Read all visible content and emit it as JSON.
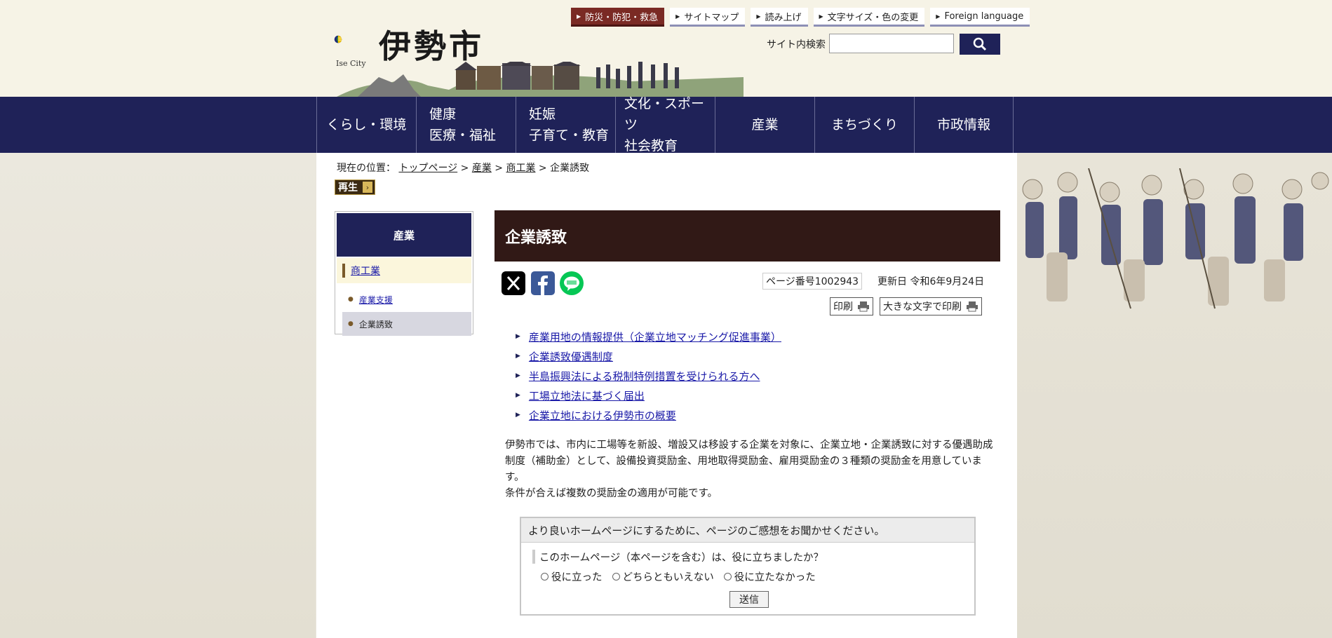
{
  "header": {
    "logo_en": "Ise City",
    "logo_jp": "伊勢市",
    "top_links": [
      {
        "label": "防災・防犯・救急"
      },
      {
        "label": "サイトマップ"
      },
      {
        "label": "読み上げ"
      },
      {
        "label": "文字サイズ・色の変更"
      },
      {
        "label": "Foreign language"
      }
    ],
    "search_label": "サイト内検索",
    "search_value": ""
  },
  "nav": {
    "items": [
      {
        "line1": "くらし・環境",
        "line2": ""
      },
      {
        "line1": "健康",
        "line2": "医療・福祉"
      },
      {
        "line1": "妊娠",
        "line2": "子育て・教育"
      },
      {
        "line1": "文化・スポーツ",
        "line2": "社会教育"
      },
      {
        "line1": "産業",
        "line2": ""
      },
      {
        "line1": "まちづくり",
        "line2": ""
      },
      {
        "line1": "市政情報",
        "line2": ""
      }
    ]
  },
  "breadcrumb": {
    "prefix": "現在の位置：",
    "items": [
      "トップページ",
      "産業",
      "商工業"
    ],
    "current": "企業誘致",
    "sep": ">"
  },
  "play_label": "再生",
  "sidebar": {
    "heading": "産業",
    "category": "商工業",
    "subitems": [
      "産業支援",
      "企業誘致"
    ]
  },
  "page": {
    "title": "企業誘致",
    "page_number": "ページ番号1002943",
    "updated": "更新日 令和6年9月24日",
    "print_label": "印刷",
    "print_large_label": "大きな文字で印刷"
  },
  "links": [
    "産業用地の情報提供（企業立地マッチング促進事業）",
    "企業誘致優遇制度",
    "半島振興法による税制特例措置を受けられる方へ",
    "工場立地法に基づく届出",
    "企業立地における伊勢市の概要"
  ],
  "body": {
    "p1": "伊勢市では、市内に工場等を新設、増設又は移設する企業を対象に、企業立地・企業誘致に対する優遇助成制度（補助金）として、設備投資奨励金、用地取得奨励金、雇用奨励金の３種類の奨励金を用意しています。",
    "p2": "条件が合えば複数の奨励金の適用が可能です。"
  },
  "feedback": {
    "heading": "より良いホームページにするために、ページのご感想をお聞かせください。",
    "question": "このホームページ（本ページを含む）は、役に立ちましたか？",
    "options": [
      "役に立った",
      "どちらともいえない",
      "役に立たなかった"
    ],
    "submit": "送信"
  },
  "colors": {
    "nav_bg": "#1f2258",
    "title_bg": "#311916",
    "disaster_bg": "#7a2a24",
    "link": "#1a1aa8"
  },
  "icons": {
    "search": "magnifier-icon",
    "sns": [
      "x-icon",
      "facebook-icon",
      "line-icon"
    ],
    "print": "printer-icon"
  }
}
